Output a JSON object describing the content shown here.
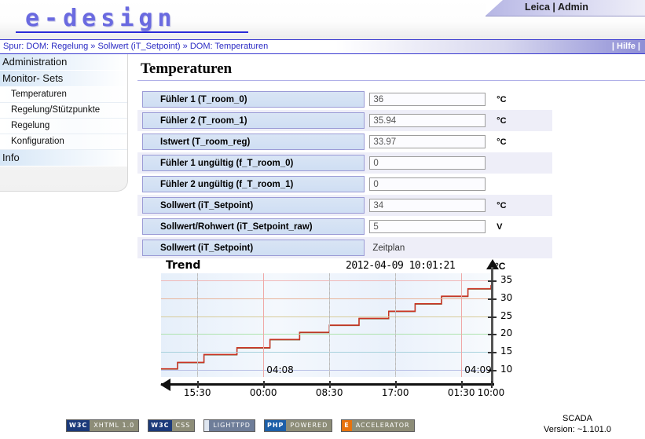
{
  "branding": {
    "logo": "e-design",
    "user": "Leica | Admin"
  },
  "breadcrumb": {
    "text": "Spur: DOM: Regelung » Sollwert (iT_Setpoint) » DOM: Temperaturen",
    "help": "| Hilfe |"
  },
  "sidebar": {
    "items": [
      {
        "label": "Administration",
        "type": "group"
      },
      {
        "label": "Monitor- Sets",
        "type": "group"
      },
      {
        "label": "Temperaturen",
        "type": "sub"
      },
      {
        "label": "Regelung/Stützpunkte",
        "type": "sub"
      },
      {
        "label": "Regelung",
        "type": "sub"
      },
      {
        "label": "Konfiguration",
        "type": "sub"
      },
      {
        "label": "Info",
        "type": "group"
      }
    ]
  },
  "main": {
    "title": "Temperaturen",
    "rows": [
      {
        "label": "Fühler 1 (T_room_0)",
        "value": "36",
        "unit": "°C",
        "kind": "input"
      },
      {
        "label": "Fühler 2 (T_room_1)",
        "value": "35.94",
        "unit": "°C",
        "kind": "input"
      },
      {
        "label": "Istwert (T_room_reg)",
        "value": "33.97",
        "unit": "°C",
        "kind": "input"
      },
      {
        "label": "Fühler 1 ungültig (f_T_room_0)",
        "value": "0",
        "unit": "",
        "kind": "input"
      },
      {
        "label": "Fühler 2 ungültig (f_T_room_1)",
        "value": "0",
        "unit": "",
        "kind": "input"
      },
      {
        "label": "Sollwert (iT_Setpoint)",
        "value": "34",
        "unit": "°C",
        "kind": "input"
      },
      {
        "label": "Sollwert/Rohwert (iT_Setpoint_raw)",
        "value": "5",
        "unit": "V",
        "kind": "input"
      },
      {
        "label": "Sollwert (iT_Setpoint)",
        "value": "Zeitplan",
        "unit": "",
        "kind": "text"
      }
    ]
  },
  "chart_data": {
    "type": "line",
    "title": "Trend",
    "timestamp": "2012-04-09 10:01:21",
    "ylabel": "°C",
    "xlabel": "",
    "ylim": [
      8,
      37
    ],
    "yticks": [
      10,
      15,
      20,
      25,
      30,
      35
    ],
    "xticks": [
      "15:30",
      "00:00",
      "08:30",
      "17:00",
      "01:30",
      "10:00"
    ],
    "day_labels": [
      "04:08",
      "04:09"
    ],
    "grid": true,
    "legend": "none",
    "series": [
      {
        "name": "Istwert (T_room_reg)",
        "color": "#7a4a20",
        "x": [
          0,
          3,
          5,
          10,
          13,
          20,
          23,
          30,
          33,
          39,
          42,
          48,
          51,
          57,
          60,
          66,
          69,
          74,
          77,
          82,
          85,
          90,
          93,
          100
        ],
        "values": [
          10.2,
          10.2,
          12.0,
          12.0,
          14.2,
          14.2,
          16.1,
          16.1,
          18.4,
          18.4,
          20.4,
          20.4,
          22.4,
          22.4,
          24.3,
          24.3,
          26.3,
          26.3,
          28.4,
          28.4,
          30.5,
          30.5,
          32.6,
          33.6
        ]
      },
      {
        "name": "Sollwert (iT_Setpoint)",
        "color": "#cc3322",
        "x": [
          0,
          3,
          5,
          10,
          13,
          20,
          23,
          30,
          33,
          39,
          42,
          48,
          51,
          57,
          60,
          66,
          69,
          74,
          77,
          82,
          85,
          90,
          93,
          100
        ],
        "values": [
          10.3,
          10.3,
          12.1,
          12.1,
          14.3,
          14.3,
          16.2,
          16.2,
          18.5,
          18.5,
          20.5,
          20.5,
          22.5,
          22.5,
          24.4,
          24.4,
          26.4,
          26.4,
          28.5,
          28.5,
          30.6,
          30.6,
          32.7,
          33.7
        ]
      }
    ]
  },
  "footer": {
    "badges": [
      {
        "left": "W3C",
        "right": "XHTML 1.0",
        "left_color": "#1b3a7a",
        "right_color": "#8d8d78"
      },
      {
        "left": "W3C",
        "right": "CSS",
        "left_color": "#1b3a7a",
        "right_color": "#8d8d78"
      },
      {
        "left": "",
        "right": "LIGHTTPD",
        "left_color": "#dfe6f0",
        "right_color": "#6e7d99"
      },
      {
        "left": "PHP",
        "right": "POWERED",
        "left_color": "#1c5fa8",
        "right_color": "#8d8d78"
      },
      {
        "left": "E",
        "right": "ACCELERATOR",
        "left_color": "#e8720c",
        "right_color": "#8d8d78"
      }
    ],
    "product": "SCADA",
    "version": "Version: ~1.101.0"
  }
}
